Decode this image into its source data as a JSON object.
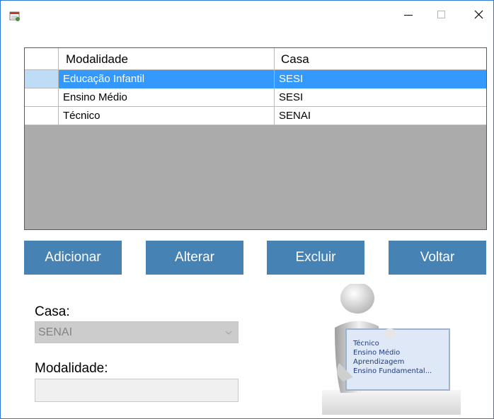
{
  "window": {
    "title": "",
    "icon": "calendar-form-icon",
    "accent": "#2b79d0"
  },
  "grid": {
    "columns": [
      "",
      "Modalidade",
      "Casa"
    ],
    "rows": [
      {
        "modalidade": "Educação Infantil",
        "casa": "SESI",
        "selected": true
      },
      {
        "modalidade": "Ensino Médio",
        "casa": "SESI",
        "selected": false
      },
      {
        "modalidade": "Técnico",
        "casa": "SENAI",
        "selected": false
      }
    ],
    "selection_color": "#3399ff",
    "empty_area_color": "#ababab"
  },
  "buttons": {
    "add": "Adicionar",
    "edit": "Alterar",
    "delete": "Excluir",
    "back": "Voltar",
    "color": "#4682b4"
  },
  "form": {
    "casa_label": "Casa:",
    "casa_value": "SENAI",
    "modalidade_label": "Modalidade:",
    "modalidade_value": ""
  },
  "illustration": {
    "icon": "person-holding-sign-illustration",
    "lines": [
      "Técnico",
      "Ensino Médio",
      "Aprendizagem",
      "Ensino Fundamental..."
    ]
  }
}
